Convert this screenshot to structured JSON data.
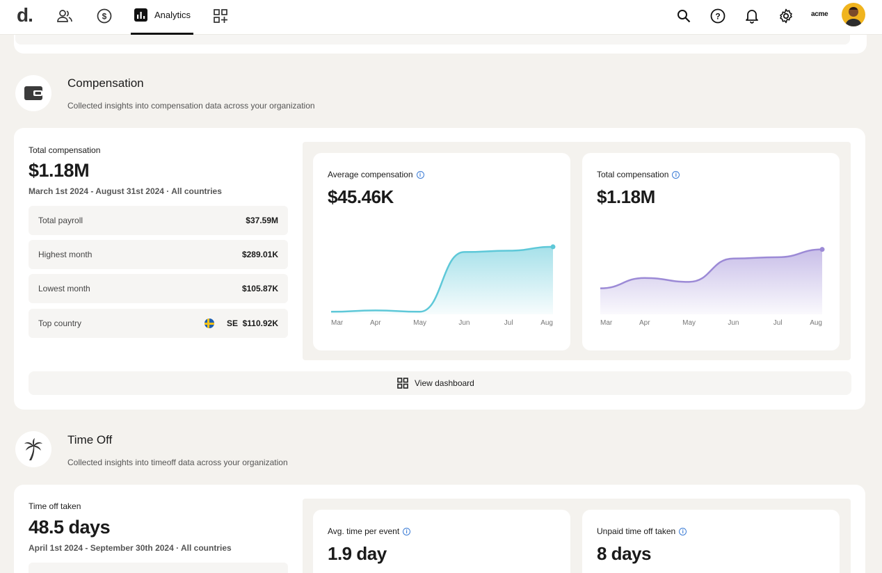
{
  "nav": {
    "logo": "d.",
    "tabs": [
      {
        "icon": "people-icon"
      },
      {
        "icon": "dollar-icon"
      },
      {
        "icon": "bar-chart-icon",
        "label": "Analytics",
        "active": true
      },
      {
        "icon": "apps-add-icon"
      }
    ],
    "right_icons": [
      "search-icon",
      "help-icon",
      "bell-icon",
      "gear-icon"
    ],
    "company": "acme"
  },
  "compensation": {
    "icon": "wallet-icon",
    "title": "Compensation",
    "subtitle": "Collected insights into compensation data across your organization",
    "total_label": "Total compensation",
    "total_value": "$1.18M",
    "range": "March 1st 2024 - August 31st 2024 · All countries",
    "rows": [
      {
        "label": "Total payroll",
        "value": "$37.59M"
      },
      {
        "label": "Highest month",
        "value": "$289.01K"
      },
      {
        "label": "Lowest month",
        "value": "$105.87K"
      },
      {
        "label": "Top country",
        "country": "SE",
        "value": "$110.92K"
      }
    ],
    "view_dashboard": "View dashboard"
  },
  "timeoff": {
    "icon": "palm-tree-icon",
    "title": "Time Off",
    "subtitle": "Collected insights into timeoff data across your organization",
    "total_label": "Time off taken",
    "total_value": "48.5 days",
    "range": "April 1st 2024 - September 30th 2024 · All countries",
    "cards": [
      {
        "title": "Avg. time per event",
        "value": "1.9 day"
      },
      {
        "title": "Unpaid time off taken",
        "value": "8 days"
      }
    ]
  },
  "chart_data": [
    {
      "type": "area",
      "title": "Average compensation",
      "headline": "$45.46K",
      "categories": [
        "Mar",
        "Apr",
        "May",
        "Jun",
        "Jul",
        "Aug"
      ],
      "values": [
        2,
        3,
        2,
        48,
        49,
        52
      ],
      "color": "#5ec8d8"
    },
    {
      "type": "area",
      "title": "Total compensation",
      "headline": "$1.18M",
      "categories": [
        "Mar",
        "Apr",
        "May",
        "Jun",
        "Jul",
        "Aug"
      ],
      "values": [
        20,
        28,
        25,
        43,
        44,
        50
      ],
      "color": "#9c8ad6"
    }
  ]
}
